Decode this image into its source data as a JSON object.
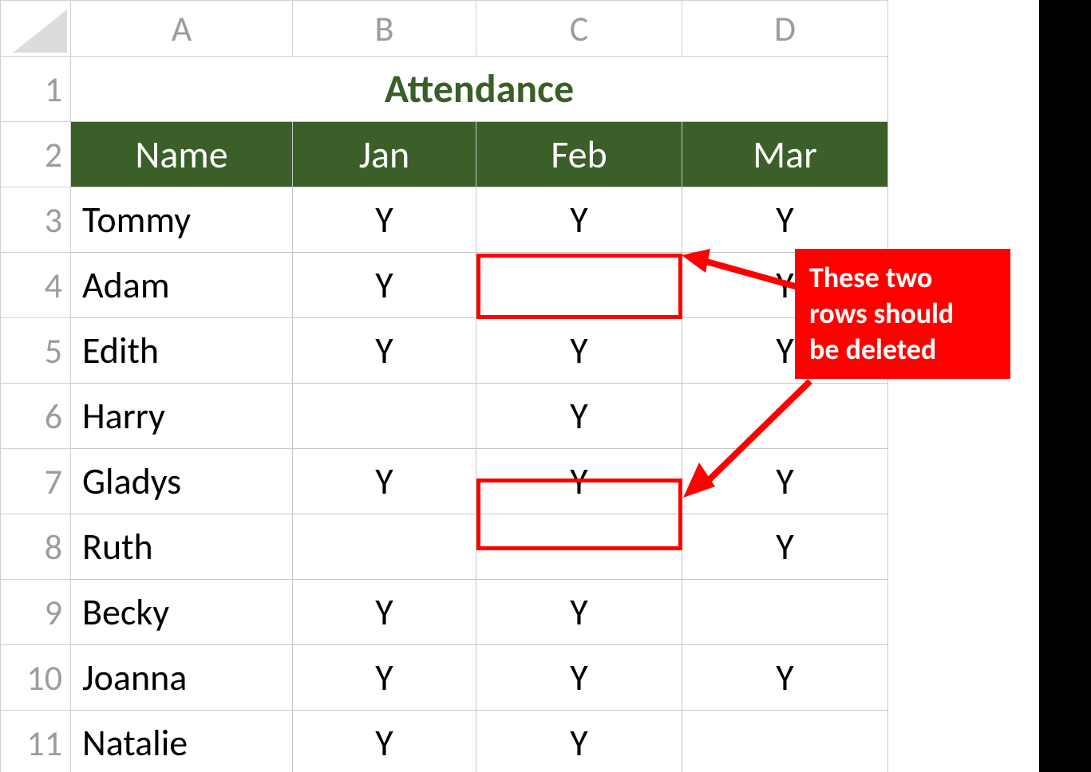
{
  "columns": {
    "a": "A",
    "b": "B",
    "c": "C",
    "d": "D"
  },
  "rowNums": {
    "r1": "1",
    "r2": "2",
    "r3": "3",
    "r4": "4",
    "r5": "5",
    "r6": "6",
    "r7": "7",
    "r8": "8",
    "r9": "9",
    "r10": "10",
    "r11": "11"
  },
  "title": "Attendance",
  "headers": {
    "name": "Name",
    "jan": "Jan",
    "feb": "Feb",
    "mar": "Mar"
  },
  "rows": [
    {
      "name": "Tommy",
      "jan": "Y",
      "feb": "Y",
      "mar": "Y"
    },
    {
      "name": "Adam",
      "jan": "Y",
      "feb": "",
      "mar": "Y"
    },
    {
      "name": "Edith",
      "jan": "Y",
      "feb": "Y",
      "mar": "Y"
    },
    {
      "name": "Harry",
      "jan": "",
      "feb": "Y",
      "mar": ""
    },
    {
      "name": "Gladys",
      "jan": "Y",
      "feb": "Y",
      "mar": "Y"
    },
    {
      "name": "Ruth",
      "jan": "",
      "feb": "",
      "mar": "Y"
    },
    {
      "name": "Becky",
      "jan": "Y",
      "feb": "Y",
      "mar": ""
    },
    {
      "name": "Joanna",
      "jan": "Y",
      "feb": "Y",
      "mar": "Y"
    },
    {
      "name": "Natalie",
      "jan": "Y",
      "feb": "Y",
      "mar": ""
    }
  ],
  "callout": {
    "line1": "These two",
    "line2": "rows should",
    "line3": "be deleted"
  }
}
